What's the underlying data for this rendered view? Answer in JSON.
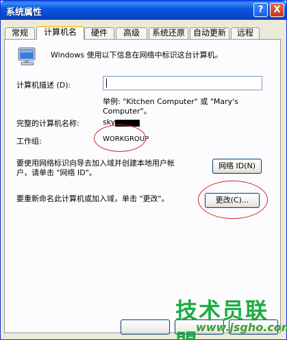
{
  "window": {
    "title": "系统属性",
    "help_label": "?",
    "close_label": "X"
  },
  "tabs": [
    {
      "label": "常规"
    },
    {
      "label": "计算机名"
    },
    {
      "label": "硬件"
    },
    {
      "label": "高级"
    },
    {
      "label": "系统还原"
    },
    {
      "label": "自动更新"
    },
    {
      "label": "远程"
    }
  ],
  "panel": {
    "intro_text": "Windows 使用以下信息在网络中标识这台计算机。",
    "description_label": "计算机描述 (D):",
    "description_value": "",
    "example_line1": "举例: \"Kitchen Computer\" 或 \"Mary's",
    "example_line2": "Computer\"。",
    "full_name_label": "完整的计算机名称:",
    "full_name_value": "sky",
    "workgroup_label": "工作组:",
    "workgroup_value": "WORKGROUP",
    "network_id_text_line1": "要使用网络标识向导去加入域并创建本地用户帐",
    "network_id_text_line2": "户，请单击 \"网络 ID\"。",
    "network_id_button": "网络 ID(N)",
    "rename_text": "要重新命名此计算机或加入域，单击 \"更改\"。",
    "change_button": "更改(C)..."
  },
  "watermark": {
    "brand": "技术员联盟",
    "url": "www.jsgho.com"
  },
  "icons": {
    "computer": "computer-icon",
    "help": "help-icon",
    "close": "close-icon"
  },
  "colors": {
    "titlebar": "#0b58e0",
    "annotation_red": "#d92020",
    "watermark_green": "#12a73a"
  }
}
